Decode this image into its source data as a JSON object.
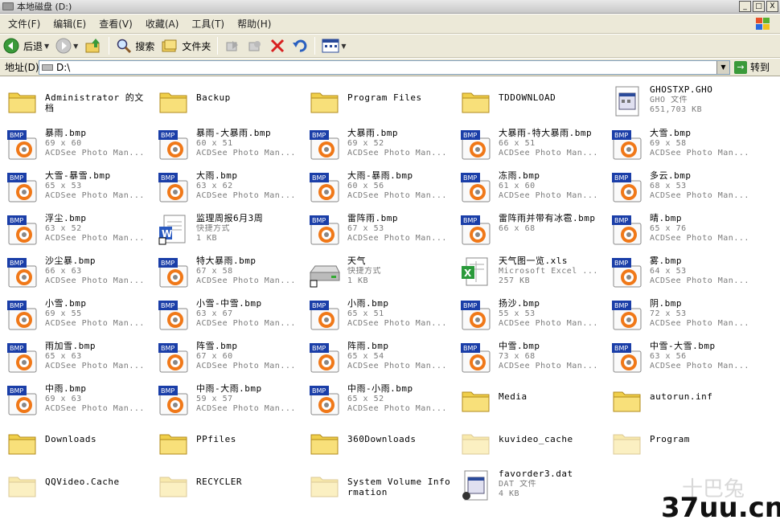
{
  "window": {
    "title": "本地磁盘 (D:)",
    "buttons": [
      "_",
      "□",
      "X"
    ]
  },
  "menu": [
    "文件(F)",
    "编辑(E)",
    "查看(V)",
    "收藏(A)",
    "工具(T)",
    "帮助(H)"
  ],
  "toolbar": {
    "back_label": "后退",
    "search_label": "搜索",
    "folders_label": "文件夹"
  },
  "address": {
    "label": "地址(D)",
    "value": "D:\\",
    "go_label": "转到"
  },
  "items": [
    {
      "type": "folder",
      "name": "Administrator 的文档",
      "l2": "",
      "l3": ""
    },
    {
      "type": "folder",
      "name": "Backup",
      "l2": "",
      "l3": ""
    },
    {
      "type": "folder",
      "name": "Program Files",
      "l2": "",
      "l3": ""
    },
    {
      "type": "folder",
      "name": "TDDOWNLOAD",
      "l2": "",
      "l3": ""
    },
    {
      "type": "ghd",
      "name": "GHOSTXP.GHO",
      "l2": "GHO 文件",
      "l3": "651,703 KB"
    },
    {
      "type": "bmp",
      "name": "暴雨.bmp",
      "l2": "69 x 60",
      "l3": "ACDSee Photo Man..."
    },
    {
      "type": "bmp",
      "name": "暴雨-大暴雨.bmp",
      "l2": "60 x 51",
      "l3": "ACDSee Photo Man..."
    },
    {
      "type": "bmp",
      "name": "大暴雨.bmp",
      "l2": "69 x 52",
      "l3": "ACDSee Photo Man..."
    },
    {
      "type": "bmp",
      "name": "大暴雨-特大暴雨.bmp",
      "l2": "66 x 51",
      "l3": "ACDSee Photo Man..."
    },
    {
      "type": "bmp",
      "name": "大雪.bmp",
      "l2": "69 x 58",
      "l3": "ACDSee Photo Man..."
    },
    {
      "type": "bmp",
      "name": "大雪-暴雪.bmp",
      "l2": "65 x 53",
      "l3": "ACDSee Photo Man..."
    },
    {
      "type": "bmp",
      "name": "大雨.bmp",
      "l2": "63 x 62",
      "l3": "ACDSee Photo Man..."
    },
    {
      "type": "bmp",
      "name": "大雨-暴雨.bmp",
      "l2": "60 x 56",
      "l3": "ACDSee Photo Man..."
    },
    {
      "type": "bmp",
      "name": "冻雨.bmp",
      "l2": "61 x 60",
      "l3": "ACDSee Photo Man..."
    },
    {
      "type": "bmp",
      "name": "多云.bmp",
      "l2": "68 x 53",
      "l3": "ACDSee Photo Man..."
    },
    {
      "type": "bmp",
      "name": "浮尘.bmp",
      "l2": "63 x 52",
      "l3": "ACDSee Photo Man..."
    },
    {
      "type": "word",
      "name": "监理周报6月3周",
      "l2": "快捷方式",
      "l3": "1 KB"
    },
    {
      "type": "bmp",
      "name": "雷阵雨.bmp",
      "l2": "67 x 53",
      "l3": "ACDSee Photo Man..."
    },
    {
      "type": "bmp",
      "name": "雷阵雨并带有冰雹.bmp",
      "l2": "66 x 68",
      "l3": ""
    },
    {
      "type": "bmp",
      "name": "晴.bmp",
      "l2": "65 x 76",
      "l3": "ACDSee Photo Man..."
    },
    {
      "type": "bmp",
      "name": "沙尘暴.bmp",
      "l2": "66 x 63",
      "l3": "ACDSee Photo Man..."
    },
    {
      "type": "bmp",
      "name": "特大暴雨.bmp",
      "l2": "67 x 58",
      "l3": "ACDSee Photo Man..."
    },
    {
      "type": "drive",
      "name": "天气",
      "l2": "快捷方式",
      "l3": "1 KB"
    },
    {
      "type": "excel",
      "name": "天气图一览.xls",
      "l2": "Microsoft Excel ...",
      "l3": "257 KB"
    },
    {
      "type": "bmp",
      "name": "雾.bmp",
      "l2": "64 x 53",
      "l3": "ACDSee Photo Man..."
    },
    {
      "type": "bmp",
      "name": "小雪.bmp",
      "l2": "69 x 55",
      "l3": "ACDSee Photo Man..."
    },
    {
      "type": "bmp",
      "name": "小雪-中雪.bmp",
      "l2": "63 x 67",
      "l3": "ACDSee Photo Man..."
    },
    {
      "type": "bmp",
      "name": "小雨.bmp",
      "l2": "65 x 51",
      "l3": "ACDSee Photo Man..."
    },
    {
      "type": "bmp",
      "name": "扬沙.bmp",
      "l2": "55 x 53",
      "l3": "ACDSee Photo Man..."
    },
    {
      "type": "bmp",
      "name": "阴.bmp",
      "l2": "72 x 53",
      "l3": "ACDSee Photo Man..."
    },
    {
      "type": "bmp",
      "name": "雨加雪.bmp",
      "l2": "65 x 63",
      "l3": "ACDSee Photo Man..."
    },
    {
      "type": "bmp",
      "name": "阵雪.bmp",
      "l2": "67 x 60",
      "l3": "ACDSee Photo Man..."
    },
    {
      "type": "bmp",
      "name": "阵雨.bmp",
      "l2": "65 x 54",
      "l3": "ACDSee Photo Man..."
    },
    {
      "type": "bmp",
      "name": "中雪.bmp",
      "l2": "73 x 68",
      "l3": "ACDSee Photo Man..."
    },
    {
      "type": "bmp",
      "name": "中雪-大雪.bmp",
      "l2": "63 x 56",
      "l3": "ACDSee Photo Man..."
    },
    {
      "type": "bmp",
      "name": "中雨.bmp",
      "l2": "69 x 63",
      "l3": "ACDSee Photo Man..."
    },
    {
      "type": "bmp",
      "name": "中雨-大雨.bmp",
      "l2": "59 x 57",
      "l3": "ACDSee Photo Man..."
    },
    {
      "type": "bmp",
      "name": "中雨-小雨.bmp",
      "l2": "65 x 52",
      "l3": "ACDSee Photo Man..."
    },
    {
      "type": "folder",
      "name": "Media",
      "l2": "",
      "l3": ""
    },
    {
      "type": "folder",
      "name": "autorun.inf",
      "l2": "",
      "l3": ""
    },
    {
      "type": "folder",
      "name": "Downloads",
      "l2": "",
      "l3": ""
    },
    {
      "type": "folder",
      "name": "PPfiles",
      "l2": "",
      "l3": ""
    },
    {
      "type": "folder",
      "name": "360Downloads",
      "l2": "",
      "l3": ""
    },
    {
      "type": "folder-faded",
      "name": "kuvideo_cache",
      "l2": "",
      "l3": ""
    },
    {
      "type": "folder-faded",
      "name": "Program",
      "l2": "",
      "l3": ""
    },
    {
      "type": "folder-faded",
      "name": "QQVideo.Cache",
      "l2": "",
      "l3": ""
    },
    {
      "type": "folder-faded",
      "name": "RECYCLER",
      "l2": "",
      "l3": ""
    },
    {
      "type": "folder-faded",
      "name": "System Volume Information",
      "l2": "",
      "l3": ""
    },
    {
      "type": "dat",
      "name": "favorder3.dat",
      "l2": "DAT 文件",
      "l3": "4 KB"
    }
  ],
  "watermark": {
    "logo_text": "十巴兔",
    "site": "37uu.cn"
  }
}
